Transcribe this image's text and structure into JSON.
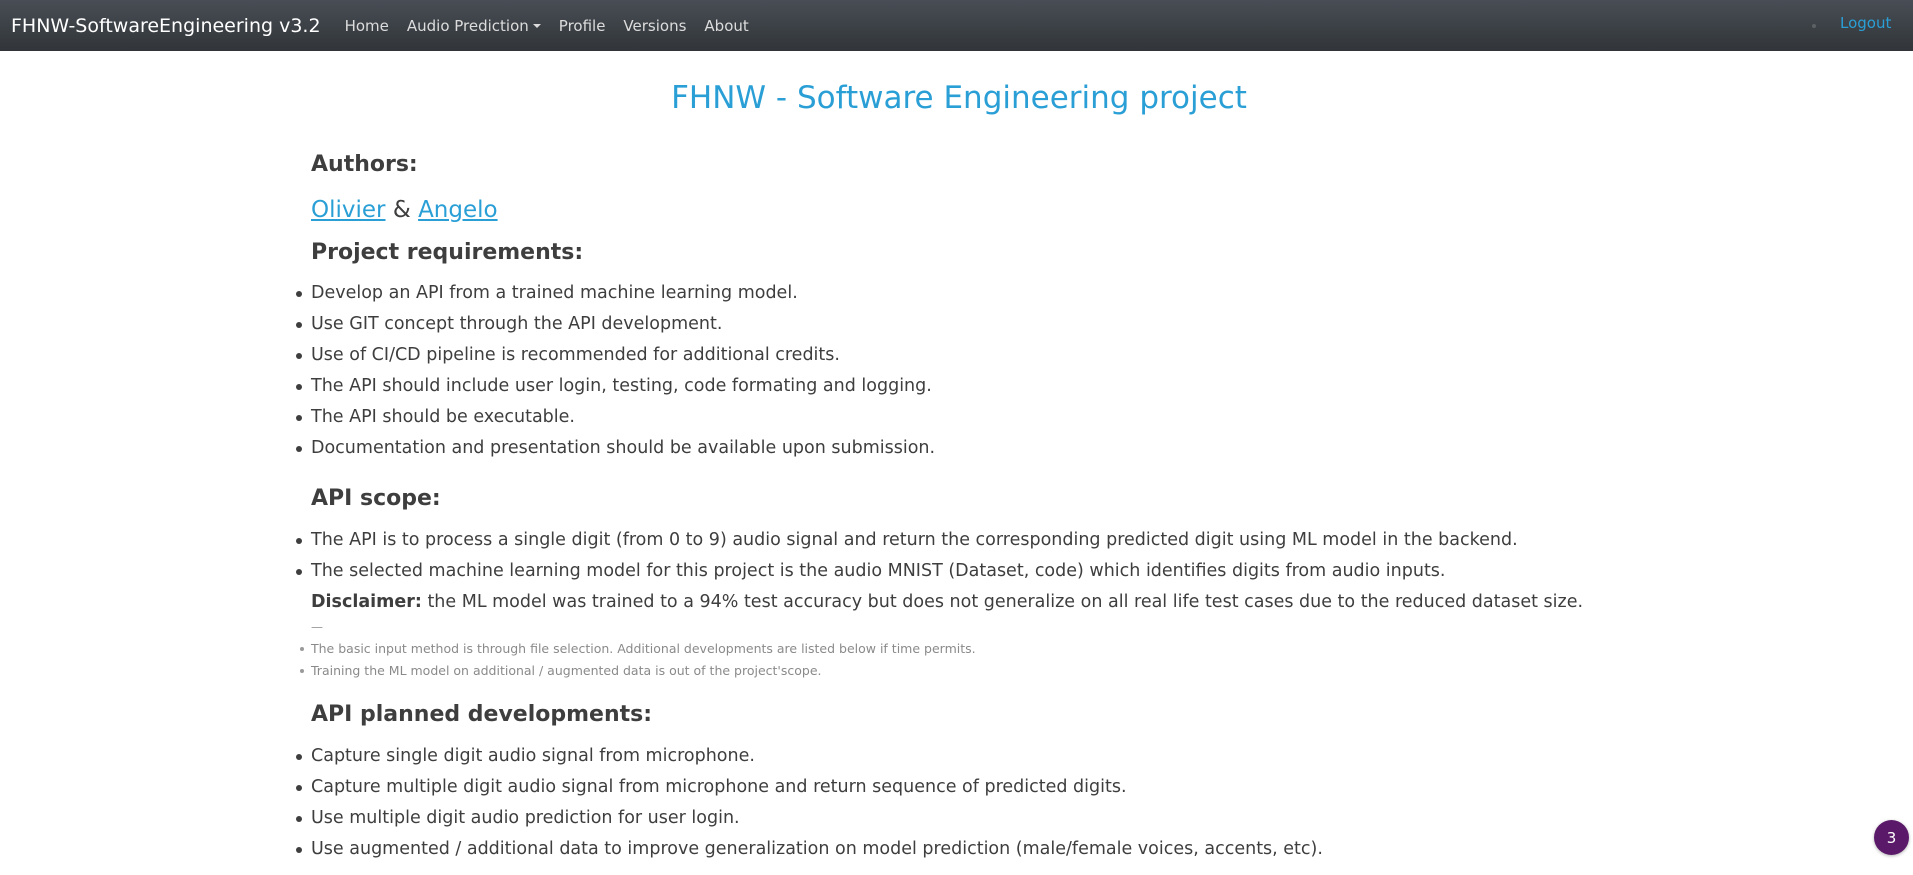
{
  "navbar": {
    "brand": "FHNW-SoftwareEngineering v3.2",
    "links": [
      {
        "label": "Home"
      },
      {
        "label": "Audio Prediction"
      },
      {
        "label": "Profile"
      },
      {
        "label": "Versions"
      },
      {
        "label": "About"
      }
    ],
    "logout": "Logout"
  },
  "page": {
    "title": "FHNW - Software Engineering project",
    "authors_heading": "Authors:",
    "authors": [
      "Olivier",
      "Angelo"
    ],
    "authors_separator": "&",
    "requirements_heading": "Project requirements:",
    "requirements": [
      "Develop an API from a trained machine learning model.",
      "Use GIT concept through the API development.",
      "Use of CI/CD pipeline is recommended for additional credits.",
      "The API should include user login, testing, code formating and logging.",
      "The API should be executable.",
      "Documentation and presentation should be available upon submission."
    ],
    "scope_heading": "API scope:",
    "scope": [
      "The API is to process a single digit (from 0 to 9) audio signal and return the corresponding predicted digit using ML model in the backend.",
      "The selected machine learning model for this project is the audio MNIST (Dataset, code) which identifies digits from audio inputs."
    ],
    "disclaimer_label": "Disclaimer:",
    "disclaimer_text": "the ML model was trained to a 94% test accuracy but does not generalize on all real life test cases due to the reduced dataset size.",
    "dash": "—",
    "notes": [
      "The basic input method is through file selection. Additional developments are listed below if time permits.",
      "Training the ML model on additional / augmented data is out of the project'scope."
    ],
    "planned_heading": "API planned developments:",
    "planned": [
      "Capture single digit audio signal from microphone.",
      "Capture multiple digit audio signal from microphone and return sequence of predicted digits.",
      "Use multiple digit audio prediction for user login.",
      "Use augmented / additional data to improve generalization on model prediction (male/female voices, accents, etc)."
    ]
  },
  "badge": {
    "count": "3"
  },
  "colors": {
    "accent": "#2a9fd6",
    "navbar": "#3a3f44",
    "badge": "#5b1a69"
  }
}
